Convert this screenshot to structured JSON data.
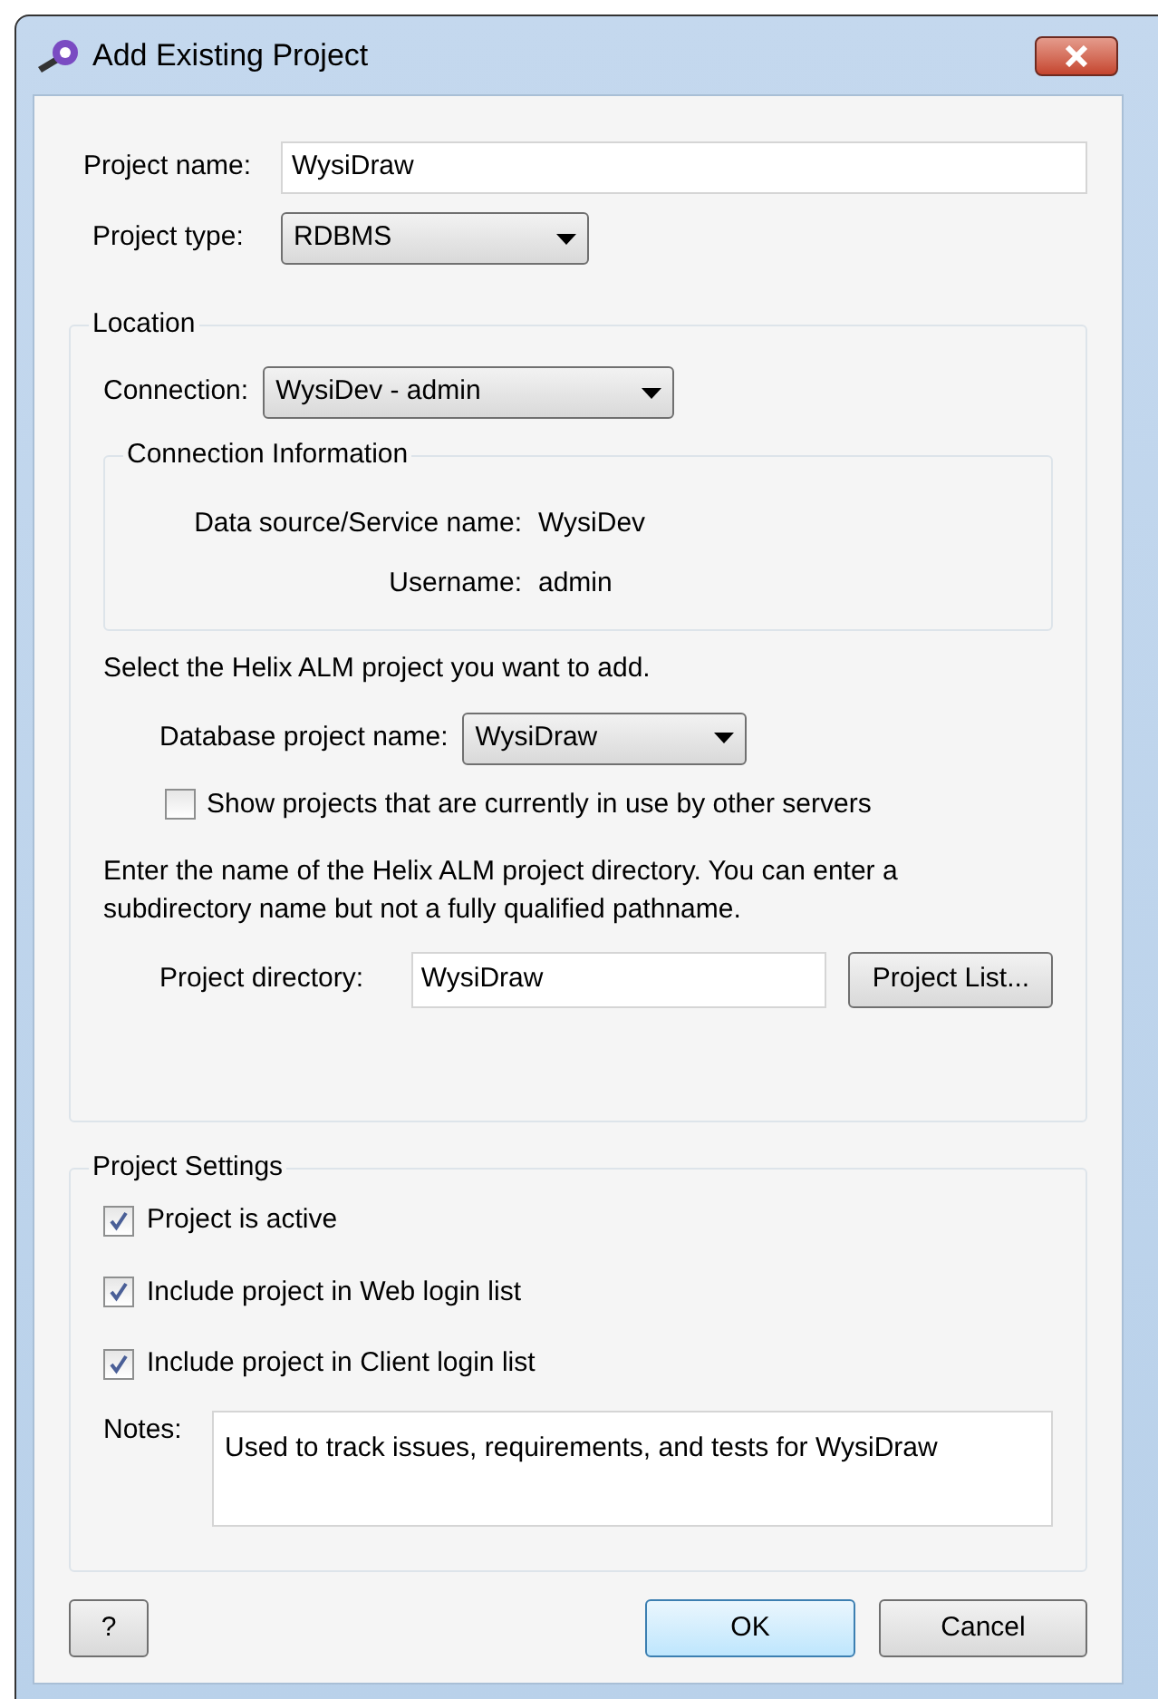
{
  "window": {
    "title": "Add Existing Project"
  },
  "project_name": {
    "label": "Project name:",
    "value": "WysiDraw"
  },
  "project_type": {
    "label": "Project type:",
    "value": "RDBMS"
  },
  "location": {
    "title": "Location",
    "connection": {
      "label": "Connection:",
      "value": "WysiDev - admin"
    },
    "connection_info": {
      "title": "Connection Information",
      "rows": [
        {
          "label": "Data source/Service name:",
          "value": "WysiDev"
        },
        {
          "label": "Username:",
          "value": "admin"
        }
      ]
    },
    "select_prompt": "Select the Helix ALM project you want to add.",
    "database_project": {
      "label": "Database project name:",
      "value": "WysiDraw"
    },
    "show_in_use": {
      "label": "Show projects that are currently in use by other servers",
      "checked": false
    },
    "directory_prompt": "Enter the name of the Helix ALM project directory. You can enter a subdirectory name but not a fully qualified pathname.",
    "project_directory": {
      "label": "Project directory:",
      "value": "WysiDraw"
    },
    "project_list_button": "Project List..."
  },
  "settings": {
    "title": "Project Settings",
    "options": [
      {
        "label": "Project is active",
        "checked": true
      },
      {
        "label": "Include project in Web login list",
        "checked": true
      },
      {
        "label": "Include project in Client login list",
        "checked": true
      }
    ],
    "notes": {
      "label": "Notes:",
      "value": "Used to track issues, requirements, and tests for WysiDraw"
    }
  },
  "buttons": {
    "help": "?",
    "ok": "OK",
    "cancel": "Cancel"
  }
}
